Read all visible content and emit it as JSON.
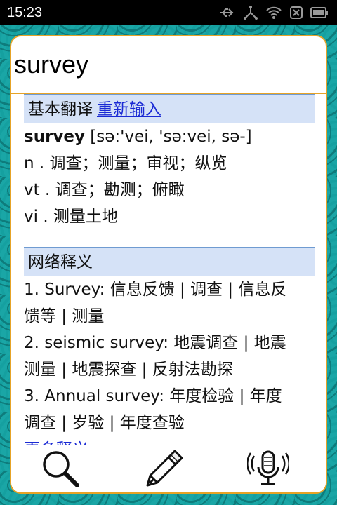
{
  "status_bar": {
    "time": "15:23",
    "icons": [
      "usb-icon",
      "share-icon",
      "wifi-icon",
      "no-sim-icon",
      "battery-icon"
    ]
  },
  "search": {
    "value": "survey"
  },
  "basic": {
    "header": "基本翻译",
    "reenter_link": "重新输入",
    "headword": "survey",
    "phonetic": " [sə:'vei, 'sə:vei, sə-]",
    "definitions": [
      "n . 调查；测量；审视；纵览",
      "vt . 调查；勘测；俯瞰",
      "vi . 测量土地"
    ]
  },
  "web": {
    "header": "网络释义",
    "lines": [
      "1. Survey: 信息反馈 | 调查 | 信息反",
      "馈等 | 测量",
      "2. seismic survey: 地震调查 | 地震",
      "测量 | 地震探查 | 反射法勘探",
      "3. Annual survey: 年度检验 | 年度",
      "调查 | 岁验 | 年度查验"
    ],
    "more": "更多释义"
  },
  "toolbar": {
    "icons": [
      "search-icon",
      "pencil-icon",
      "microphone-icon"
    ]
  },
  "colors": {
    "accent": "#e6a326",
    "header_bg": "#d5e2f7",
    "link": "#1a2ad4",
    "background": "#1aa6a6"
  }
}
